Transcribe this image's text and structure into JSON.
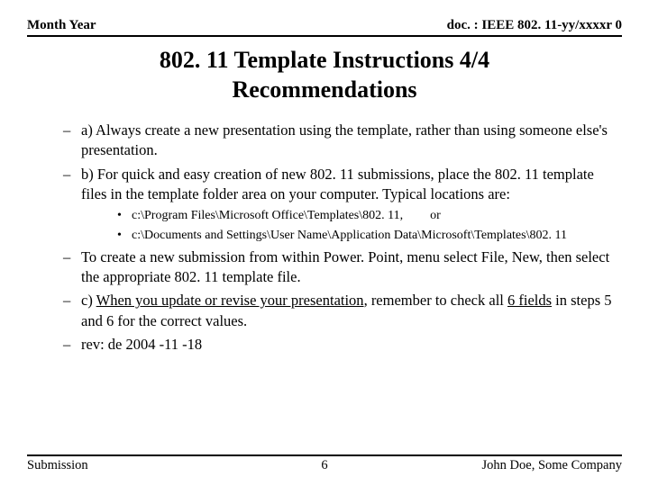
{
  "header": {
    "left": "Month Year",
    "right": "doc. : IEEE 802. 11-yy/xxxxr 0"
  },
  "title": {
    "line1": "802. 11 Template Instructions 4/4",
    "line2": "Recommendations"
  },
  "items": {
    "a": "a) Always create a new presentation using the template, rather than using someone else's presentation.",
    "b": "b) For quick and easy creation of new 802. 11 submissions, place the 802. 11 template files in the template folder area on your computer.  Typical locations are:",
    "sub1": "c:\\Program Files\\Microsoft Office\\Templates\\802. 11,",
    "sub1_or": "or",
    "sub2": "c:\\Documents and Settings\\User Name\\Application Data\\Microsoft\\Templates\\802. 11",
    "newsub": "To create a new submission from within Power. Point, menu select File, New, then select the appropriate 802. 11 template file.",
    "c_prefix": "c) ",
    "c_underlined": "When you update or revise your presentation",
    "c_mid": ", remember to check all ",
    "c_fields": "6 fields",
    "c_suffix": " in steps 5 and 6 for the correct values.",
    "rev": "rev: de 2004 -11 -18"
  },
  "footer": {
    "left": "Submission",
    "center": "6",
    "right": "John Doe, Some Company"
  },
  "glyphs": {
    "dash": "–",
    "bullet": "•"
  }
}
